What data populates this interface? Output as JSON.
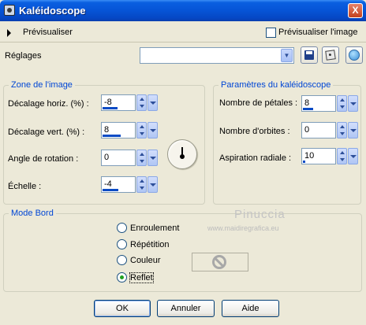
{
  "window": {
    "title": "Kaléidoscope",
    "close_glyph": "X"
  },
  "preview": {
    "toggle_label": "Prévisualiser",
    "image_checkbox_label": "Prévisualiser l'image",
    "image_checked": false
  },
  "presets": {
    "label": "Réglages",
    "value": ""
  },
  "zone": {
    "title": "Zone de l'image",
    "fields": [
      {
        "label": "Décalage horiz. (%) :",
        "value": "-8",
        "fill": 0.46
      },
      {
        "label": "Décalage vert. (%) :",
        "value": "8",
        "fill": 0.54
      },
      {
        "label": "Angle de rotation :",
        "value": "0",
        "fill": 0.0
      },
      {
        "label": "Échelle :",
        "value": "-4",
        "fill": 0.48
      }
    ]
  },
  "params": {
    "title": "Paramètres du kaléidoscope",
    "fields": [
      {
        "label": "Nombre de pétales :",
        "value": "8",
        "fill": 0.32
      },
      {
        "label": "Nombre d'orbites :",
        "value": "0",
        "fill": 0.0
      },
      {
        "label": "Aspiration radiale :",
        "value": "10",
        "fill": 0.08
      }
    ]
  },
  "mode": {
    "title": "Mode Bord",
    "options": [
      {
        "label": "Enroulement",
        "checked": false
      },
      {
        "label": "Répétition",
        "checked": false
      },
      {
        "label": "Couleur",
        "checked": false
      },
      {
        "label": "Reflet",
        "checked": true
      }
    ]
  },
  "watermark": {
    "name": "Pinuccia",
    "url": "www.maidiregrafica.eu"
  },
  "buttons": {
    "ok": "OK",
    "cancel": "Annuler",
    "help": "Aide"
  },
  "icons": {
    "save": "save-disk-icon",
    "random": "random-dice-icon",
    "reset": "reset-icon",
    "no_color": "no-sign-icon"
  },
  "colors": {
    "title_bar": "#0654d6",
    "group_title": "#0046d5",
    "radio_checked": "#21a121"
  }
}
